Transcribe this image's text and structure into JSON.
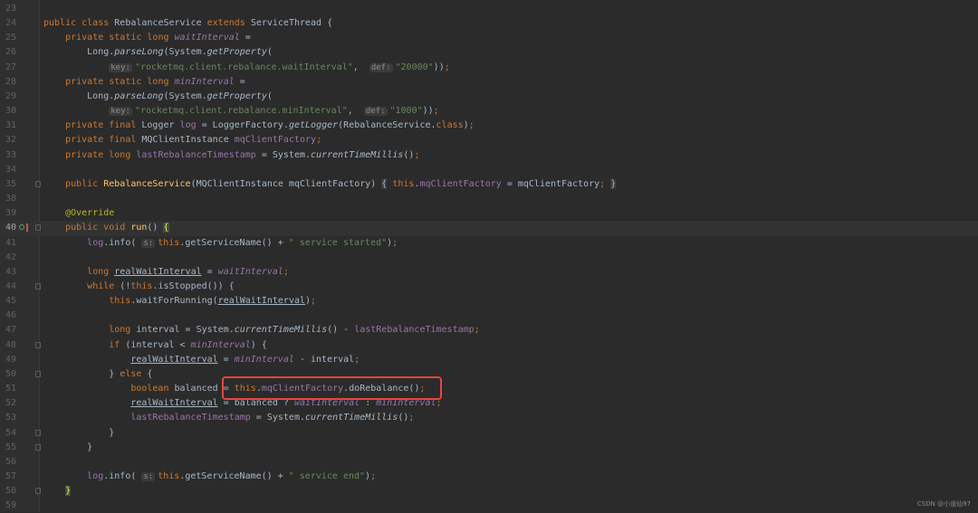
{
  "editor": {
    "current_line": "40",
    "highlight_color": "#e8443f",
    "lines": [
      {
        "n": "23",
        "t": []
      },
      {
        "n": "24",
        "t": [
          [
            "k",
            "public class "
          ],
          [
            "p",
            "RebalanceService "
          ],
          [
            "k",
            "extends "
          ],
          [
            "p",
            "ServiceThread {"
          ]
        ]
      },
      {
        "n": "25",
        "t": [
          [
            "p",
            "    "
          ],
          [
            "k",
            "private static long "
          ],
          [
            "fi",
            "waitInterval"
          ],
          [
            "p",
            " ="
          ]
        ]
      },
      {
        "n": "26",
        "t": [
          [
            "p",
            "        Long."
          ],
          [
            "i",
            "parseLong"
          ],
          [
            "p",
            "(System."
          ],
          [
            "i",
            "getProperty"
          ],
          [
            "p",
            "("
          ]
        ]
      },
      {
        "n": "27",
        "t": [
          [
            "p",
            "            "
          ],
          [
            "h",
            "key:"
          ],
          [
            "s",
            "\"rocketmq.client.rebalance.waitInterval\""
          ],
          [
            "p",
            ",  "
          ],
          [
            "h",
            "def:"
          ],
          [
            "s",
            "\"20000\""
          ],
          [
            "p",
            "))"
          ],
          [
            "k",
            ";"
          ]
        ]
      },
      {
        "n": "28",
        "t": [
          [
            "p",
            "    "
          ],
          [
            "k",
            "private static long "
          ],
          [
            "fi",
            "minInterval"
          ],
          [
            "p",
            " ="
          ]
        ]
      },
      {
        "n": "29",
        "t": [
          [
            "p",
            "        Long."
          ],
          [
            "i",
            "parseLong"
          ],
          [
            "p",
            "(System."
          ],
          [
            "i",
            "getProperty"
          ],
          [
            "p",
            "("
          ]
        ]
      },
      {
        "n": "30",
        "t": [
          [
            "p",
            "            "
          ],
          [
            "h",
            "key:"
          ],
          [
            "s",
            "\"rocketmq.client.rebalance.minInterval\""
          ],
          [
            "p",
            ",  "
          ],
          [
            "h",
            "def:"
          ],
          [
            "s",
            "\"1000\""
          ],
          [
            "p",
            "))"
          ],
          [
            "k",
            ";"
          ]
        ]
      },
      {
        "n": "31",
        "t": [
          [
            "p",
            "    "
          ],
          [
            "k",
            "private final "
          ],
          [
            "p",
            "Logger "
          ],
          [
            "f",
            "log"
          ],
          [
            "p",
            " = LoggerFactory."
          ],
          [
            "i",
            "getLogger"
          ],
          [
            "p",
            "(RebalanceService."
          ],
          [
            "k",
            "class"
          ],
          [
            "p",
            ")"
          ],
          [
            "k",
            ";"
          ]
        ]
      },
      {
        "n": "32",
        "t": [
          [
            "p",
            "    "
          ],
          [
            "k",
            "private final "
          ],
          [
            "p",
            "MQClientInstance "
          ],
          [
            "f",
            "mqClientFactory"
          ],
          [
            "k",
            ";"
          ]
        ]
      },
      {
        "n": "33",
        "t": [
          [
            "p",
            "    "
          ],
          [
            "k",
            "private long "
          ],
          [
            "f",
            "lastRebalanceTimestamp"
          ],
          [
            "p",
            " = System."
          ],
          [
            "i",
            "currentTimeMillis"
          ],
          [
            "p",
            "()"
          ],
          [
            "k",
            ";"
          ]
        ]
      },
      {
        "n": "34",
        "t": []
      },
      {
        "n": "35",
        "fold": true,
        "t": [
          [
            "p",
            "    "
          ],
          [
            "k",
            "public "
          ],
          [
            "m",
            "RebalanceService"
          ],
          [
            "p",
            "(MQClientInstance mqClientFactory) "
          ],
          [
            "b",
            "{"
          ],
          [
            "p",
            " "
          ],
          [
            "k",
            "this"
          ],
          [
            "p",
            "."
          ],
          [
            "f",
            "mqClientFactory"
          ],
          [
            "p",
            " = mqClientFactory"
          ],
          [
            "k",
            ";"
          ],
          [
            "p",
            " "
          ],
          [
            "b",
            "}"
          ]
        ]
      },
      {
        "n": "38",
        "t": []
      },
      {
        "n": "39",
        "t": [
          [
            "p",
            "    "
          ],
          [
            "a",
            "@Override"
          ]
        ]
      },
      {
        "n": "40",
        "fold": true,
        "t": [
          [
            "p",
            "    "
          ],
          [
            "k",
            "public void "
          ],
          [
            "m",
            "run"
          ],
          [
            "p",
            "() "
          ],
          [
            "y",
            "{"
          ]
        ]
      },
      {
        "n": "41",
        "t": [
          [
            "p",
            "        "
          ],
          [
            "f",
            "log"
          ],
          [
            "p",
            ".info( "
          ],
          [
            "h",
            "s:"
          ],
          [
            "k",
            "this"
          ],
          [
            "p",
            ".getServiceName() + "
          ],
          [
            "s",
            "\" service started\""
          ],
          [
            "p",
            ")"
          ],
          [
            "k",
            ";"
          ]
        ]
      },
      {
        "n": "42",
        "t": []
      },
      {
        "n": "43",
        "t": [
          [
            "p",
            "        "
          ],
          [
            "k",
            "long "
          ],
          [
            "u",
            "realWaitInterval"
          ],
          [
            "p",
            " = "
          ],
          [
            "fi",
            "waitInterval"
          ],
          [
            "k",
            ";"
          ]
        ]
      },
      {
        "n": "44",
        "fold": true,
        "t": [
          [
            "p",
            "        "
          ],
          [
            "k",
            "while "
          ],
          [
            "p",
            "(!"
          ],
          [
            "k",
            "this"
          ],
          [
            "p",
            ".isStopped()) {"
          ]
        ]
      },
      {
        "n": "45",
        "t": [
          [
            "p",
            "            "
          ],
          [
            "k",
            "this"
          ],
          [
            "p",
            ".waitForRunning("
          ],
          [
            "u",
            "realWaitInterval"
          ],
          [
            "p",
            ")"
          ],
          [
            "k",
            ";"
          ]
        ]
      },
      {
        "n": "46",
        "t": []
      },
      {
        "n": "47",
        "t": [
          [
            "p",
            "            "
          ],
          [
            "k",
            "long "
          ],
          [
            "p",
            "interval = System."
          ],
          [
            "i",
            "currentTimeMillis"
          ],
          [
            "p",
            "() - "
          ],
          [
            "f",
            "lastRebalanceTimestamp"
          ],
          [
            "k",
            ";"
          ]
        ]
      },
      {
        "n": "48",
        "fold": true,
        "t": [
          [
            "p",
            "            "
          ],
          [
            "k",
            "if "
          ],
          [
            "p",
            "(interval < "
          ],
          [
            "fi",
            "minInterval"
          ],
          [
            "p",
            ") {"
          ]
        ]
      },
      {
        "n": "49",
        "t": [
          [
            "p",
            "                "
          ],
          [
            "u",
            "realWaitInterval"
          ],
          [
            "p",
            " = "
          ],
          [
            "fi",
            "minInterval"
          ],
          [
            "p",
            " - interval"
          ],
          [
            "k",
            ";"
          ]
        ]
      },
      {
        "n": "50",
        "fold": true,
        "t": [
          [
            "p",
            "            } "
          ],
          [
            "k",
            "else "
          ],
          [
            "p",
            "{"
          ]
        ]
      },
      {
        "n": "51",
        "t": [
          [
            "p",
            "                "
          ],
          [
            "k",
            "boolean "
          ],
          [
            "p",
            "balanced = "
          ],
          [
            "k",
            "this"
          ],
          [
            "p",
            "."
          ],
          [
            "f",
            "mqClientFactory"
          ],
          [
            "p",
            ".doRebalance()"
          ],
          [
            "k",
            ";"
          ]
        ]
      },
      {
        "n": "52",
        "t": [
          [
            "p",
            "                "
          ],
          [
            "u",
            "realWaitInterval"
          ],
          [
            "p",
            " = balanced ? "
          ],
          [
            "fi",
            "waitInterval"
          ],
          [
            "p",
            " : "
          ],
          [
            "fi",
            "minInterval"
          ],
          [
            "k",
            ";"
          ]
        ]
      },
      {
        "n": "53",
        "t": [
          [
            "p",
            "                "
          ],
          [
            "f",
            "lastRebalanceTimestamp"
          ],
          [
            "p",
            " = System."
          ],
          [
            "i",
            "currentTimeMillis"
          ],
          [
            "p",
            "()"
          ],
          [
            "k",
            ";"
          ]
        ]
      },
      {
        "n": "54",
        "fold": true,
        "t": [
          [
            "p",
            "            }"
          ]
        ]
      },
      {
        "n": "55",
        "fold": true,
        "t": [
          [
            "p",
            "        }"
          ]
        ]
      },
      {
        "n": "56",
        "t": []
      },
      {
        "n": "57",
        "t": [
          [
            "p",
            "        "
          ],
          [
            "f",
            "log"
          ],
          [
            "p",
            ".info( "
          ],
          [
            "h",
            "s:"
          ],
          [
            "k",
            "this"
          ],
          [
            "p",
            ".getServiceName() + "
          ],
          [
            "s",
            "\" service end\""
          ],
          [
            "p",
            ")"
          ],
          [
            "k",
            ";"
          ]
        ]
      },
      {
        "n": "58",
        "fold": true,
        "t": [
          [
            "p",
            "    "
          ],
          [
            "y",
            "}"
          ]
        ]
      },
      {
        "n": "59",
        "t": []
      }
    ]
  },
  "watermark": "CSDN @小道仙97"
}
